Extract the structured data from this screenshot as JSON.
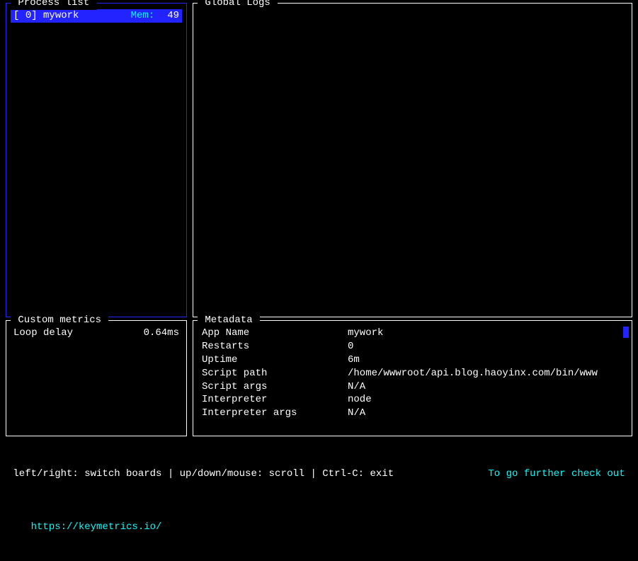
{
  "panels": {
    "process_list": {
      "title": " Process list ",
      "items": [
        {
          "id_open": "[ ",
          "id": "0",
          "id_close": "] ",
          "name": "mywork",
          "mem_label": "Mem:",
          "mem_value": "49"
        }
      ]
    },
    "global_logs": {
      "title": " Global Logs "
    },
    "custom_metrics": {
      "title": " Custom metrics ",
      "rows": [
        {
          "label": "Loop delay",
          "value": "0.64ms"
        }
      ]
    },
    "metadata": {
      "title": " Metadata ",
      "rows": [
        {
          "label": "App Name",
          "value": "mywork"
        },
        {
          "label": "Restarts",
          "value": "0"
        },
        {
          "label": "Uptime",
          "value": "6m"
        },
        {
          "label": "Script path",
          "value": "/home/wwwroot/api.blog.haoyinx.com/bin/www"
        },
        {
          "label": "Script args",
          "value": "N/A"
        },
        {
          "label": "Interpreter",
          "value": "node"
        },
        {
          "label": "Interpreter args",
          "value": "N/A"
        }
      ]
    }
  },
  "footer": {
    "hints": " left/right: switch boards | up/down/mouse: scroll | Ctrl-C: exit",
    "cta": "To go further check out ",
    "link": "https://keymetrics.io/"
  }
}
